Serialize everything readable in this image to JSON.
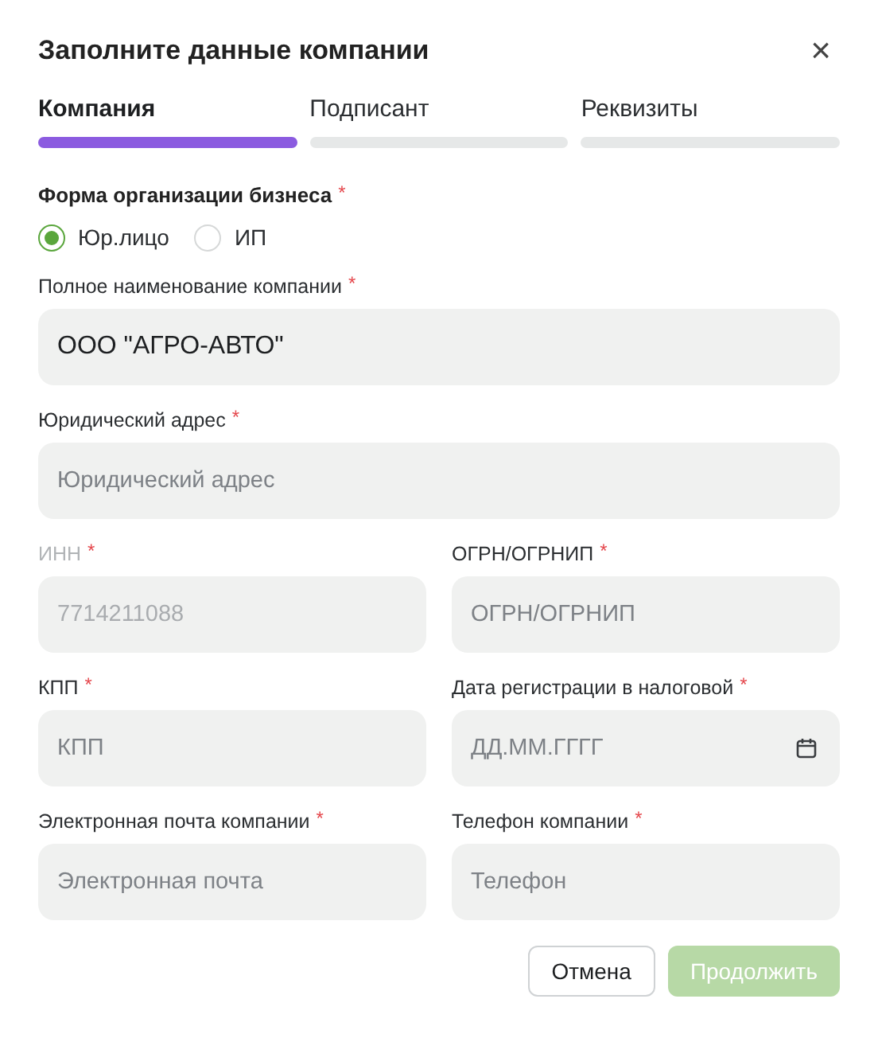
{
  "dialog": {
    "title": "Заполните данные компании",
    "close_label": "×"
  },
  "steps": [
    {
      "label": "Компания",
      "selected": true
    },
    {
      "label": "Подписант",
      "selected": false
    },
    {
      "label": "Реквизиты",
      "selected": false
    }
  ],
  "business_form": {
    "label": "Форма организации бизнеса",
    "required_mark": "*",
    "options": [
      {
        "label": "Юр.лицо",
        "selected": true
      },
      {
        "label": "ИП",
        "selected": false
      }
    ]
  },
  "fields": [
    {
      "label": "Полное наименование компании",
      "required_mark": "*",
      "value": "ООО \"АГРО-АВТО\"",
      "disabled": false,
      "wide": true,
      "kind": "text"
    },
    {
      "label": "Юридический адрес",
      "required_mark": "*",
      "placeholder": "Юридический адрес",
      "disabled": false,
      "wide": true,
      "kind": "text"
    },
    {
      "label": "ИНН",
      "required_mark": "*",
      "value": "7714211088",
      "disabled": true,
      "wide": false,
      "kind": "text"
    },
    {
      "label": "ОГРН/ОГРНИП",
      "required_mark": "*",
      "placeholder": "ОГРН/ОГРНИП",
      "disabled": false,
      "wide": false,
      "kind": "text"
    },
    {
      "label": "КПП",
      "required_mark": "*",
      "placeholder": "КПП",
      "disabled": false,
      "wide": false,
      "kind": "text"
    },
    {
      "label": "Дата регистрации в налоговой",
      "required_mark": "*",
      "placeholder": "ДД.ММ.ГГГГ",
      "disabled": false,
      "wide": false,
      "kind": "date"
    },
    {
      "label": "Электронная почта компании",
      "required_mark": "*",
      "placeholder": "Электронная почта",
      "disabled": false,
      "wide": false,
      "kind": "text"
    },
    {
      "label": "Телефон компании",
      "required_mark": "*",
      "placeholder": "Телефон",
      "disabled": false,
      "wide": false,
      "kind": "text"
    }
  ],
  "buttons": [
    {
      "label": "Отмена",
      "kind": "secondary",
      "disabled": false
    },
    {
      "label": "Продолжить",
      "kind": "primary",
      "disabled": true
    }
  ]
}
